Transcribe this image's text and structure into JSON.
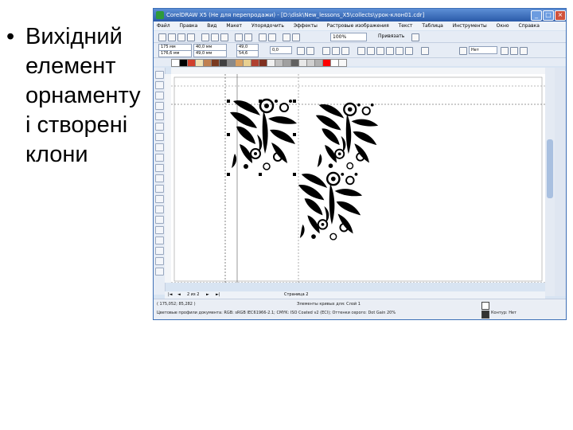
{
  "slide": {
    "bullet_char": "•",
    "lines": [
      "Вихідний",
      "елемент",
      "орнаменту",
      "і створені",
      "клони"
    ]
  },
  "app": {
    "title": "CorelDRAW X5 (Не для перепродажи) - [D:\\disk\\New_lessons_X5\\collects\\урок-клон01.cdr]",
    "window_buttons": [
      "_",
      "□",
      "×"
    ],
    "menu": [
      "Файл",
      "Правка",
      "Вид",
      "Макет",
      "Упорядочить",
      "Эффекты",
      "Растровые изображения",
      "Текст",
      "Таблица",
      "Инструменты",
      "Окно",
      "Справка"
    ],
    "zoom": "100%",
    "snap_label": "Привязать",
    "pos_x": "175 мм",
    "pos_y": "176,6 мм",
    "size_w": "40,0 мм",
    "size_h": "49,0 мм",
    "scale_x": "49,0",
    "scale_y": "54,6",
    "angle": "0,0",
    "outline": "Нет",
    "page_label": "2 из 2",
    "page_tab": "Страница 2",
    "status_coords": "( 175,052; 85,282 )",
    "status_object": "Элементы кривых для: Слой 1",
    "status_fill": "Цветовые профили документа: RGB: sRGB IEC61966-2.1; CMYK: ISO Coated v2 (ECI); Оттенки серого: Dot Gain 20%",
    "status_outline": "Контур: Нет"
  },
  "colors": {
    "title_bar": "#2a5aa8",
    "chrome": "#d8e4f2",
    "palette": [
      "#ffffff",
      "#000000",
      "#d0402b",
      "#f0e0b0",
      "#c08050",
      "#7a3a20",
      "#404040",
      "#8a8a8a",
      "#d8a060",
      "#e8d090",
      "#b04030",
      "#803020",
      "#f0f0f0",
      "#c0c0c0",
      "#a0a0a0",
      "#606060",
      "#e8e8e8",
      "#d0d0d0",
      "#b0b0b0",
      "#ff0000",
      "#ffffff",
      "#f8f8f8"
    ]
  }
}
